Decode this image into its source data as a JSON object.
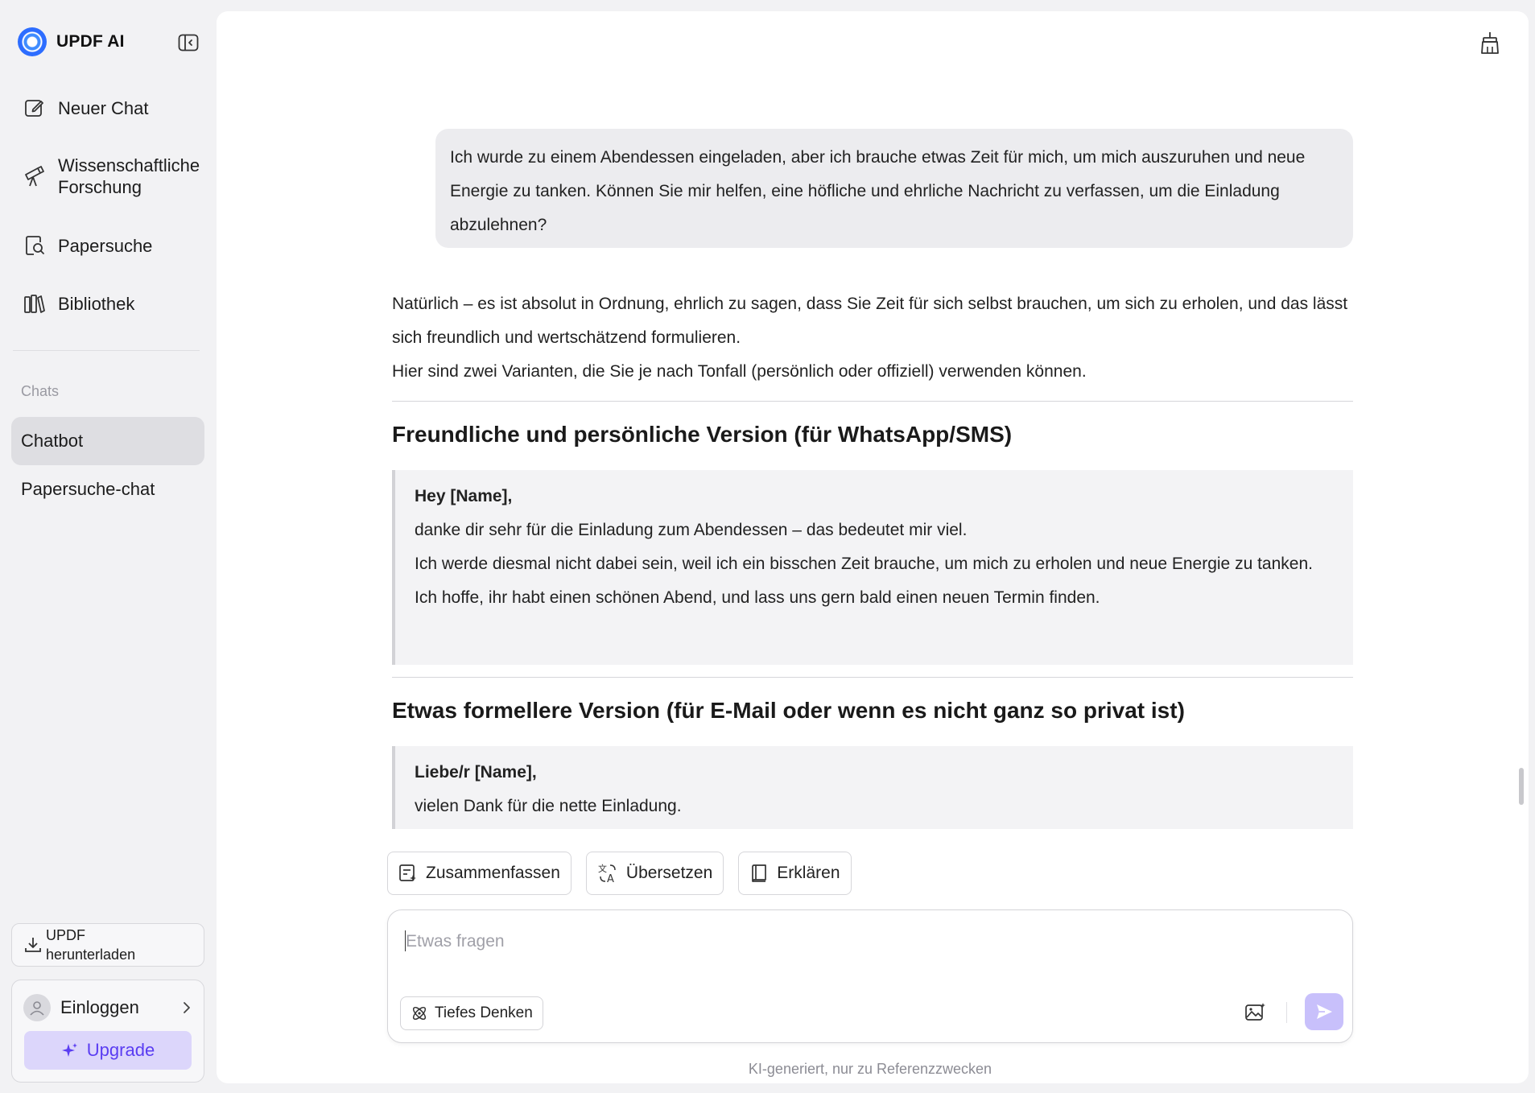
{
  "sidebar": {
    "brand_name": "UPDF AI",
    "nav": [
      {
        "label": "Neuer Chat",
        "icon": "new-chat-icon"
      },
      {
        "label": "Wissenschaftliche Forschung",
        "icon": "telescope-icon"
      },
      {
        "label": "Papersuche",
        "icon": "paper-search-icon"
      },
      {
        "label": "Bibliothek",
        "icon": "library-icon"
      }
    ],
    "chats_heading": "Chats",
    "chats": [
      {
        "label": "Chatbot",
        "active": true
      },
      {
        "label": "Papersuche-chat",
        "active": false
      }
    ],
    "download_label": "UPDF herunterladen",
    "login_label": "Einloggen",
    "upgrade_label": "Upgrade",
    "accent_color": "#5a3df2"
  },
  "conversation": {
    "user_message": "Ich wurde zu einem Abendessen eingeladen, aber ich brauche etwas Zeit für mich, um mich auszuruhen und neue Energie zu tanken. Können Sie mir helfen, eine höfliche und ehrliche Nachricht zu verfassen, um die Einladung abzulehnen?",
    "answer_intro_1": "Natürlich – es ist absolut in Ordnung, ehrlich zu sagen, dass Sie Zeit für sich selbst brauchen, um sich zu erholen, und das lässt sich freundlich und wertschätzend formulieren.",
    "answer_intro_2": "Hier sind zwei Varianten, die Sie je nach Tonfall (persönlich oder offiziell) verwenden können.",
    "section1_title": "Freundliche und persönliche Version (für WhatsApp/SMS)",
    "section1_quote": {
      "greeting": "Hey [Name],",
      "lines": [
        "danke dir sehr für die Einladung zum Abendessen – das bedeutet mir viel.",
        "Ich werde diesmal nicht dabei sein, weil ich ein bisschen Zeit brauche, um mich zu erholen und neue Energie zu tanken.",
        "Ich hoffe, ihr habt einen schönen Abend, und lass uns gern bald einen neuen Termin finden."
      ]
    },
    "section2_title": "Etwas formellere Version (für E-Mail oder wenn es nicht ganz so privat ist)",
    "section2_quote": {
      "greeting": "Liebe/r [Name],",
      "lines": [
        "vielen Dank für die nette Einladung."
      ]
    }
  },
  "quick_actions": [
    {
      "label": "Zusammenfassen",
      "icon": "summarize-icon"
    },
    {
      "label": "Übersetzen",
      "icon": "translate-icon"
    },
    {
      "label": "Erklären",
      "icon": "book-icon"
    }
  ],
  "composer": {
    "placeholder": "Etwas fragen",
    "value": "",
    "deep_thinking_label": "Tiefes Denken",
    "send_color": "#c8c0fb"
  },
  "footer_note": "KI-generiert, nur zu Referenzzwecken"
}
